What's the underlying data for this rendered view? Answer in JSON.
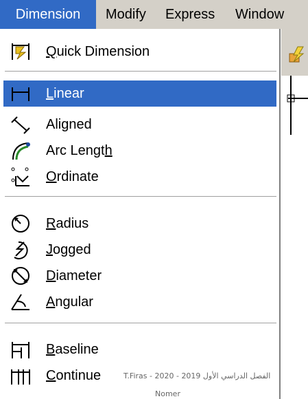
{
  "menubar": {
    "items": [
      {
        "label": "Dimension",
        "active": true
      },
      {
        "label": "Modify"
      },
      {
        "label": "Express"
      },
      {
        "label": "Window"
      }
    ]
  },
  "menu": {
    "items": [
      {
        "label": "Quick Dimension",
        "icon": "quick-dimension-icon",
        "mnemonic": "Q"
      },
      {
        "label": "Linear",
        "icon": "linear-icon",
        "mnemonic": "L",
        "highlighted": true
      },
      {
        "label": "Aligned",
        "icon": "aligned-icon"
      },
      {
        "label": "Arc Length",
        "icon": "arc-length-icon",
        "mnemonic": "h"
      },
      {
        "label": "Ordinate",
        "icon": "ordinate-icon",
        "mnemonic": "O"
      },
      {
        "label": "Radius",
        "icon": "radius-icon",
        "mnemonic": "R"
      },
      {
        "label": "Jogged",
        "icon": "jogged-icon",
        "mnemonic": "J"
      },
      {
        "label": "Diameter",
        "icon": "diameter-icon",
        "mnemonic": "D"
      },
      {
        "label": "Angular",
        "icon": "angular-icon",
        "mnemonic": "A"
      },
      {
        "label": "Baseline",
        "icon": "baseline-icon",
        "mnemonic": "B"
      },
      {
        "label": "Continue",
        "icon": "continue-icon",
        "mnemonic": "C"
      }
    ]
  },
  "footer": {
    "text": "الفصل الدراسي الأول 2019 - 2020  -  T.Firas",
    "text2": "Nomer"
  },
  "colors": {
    "highlight": "#316ac5",
    "menu_bg": "#ffffff",
    "bar_bg": "#d4d0c8"
  }
}
